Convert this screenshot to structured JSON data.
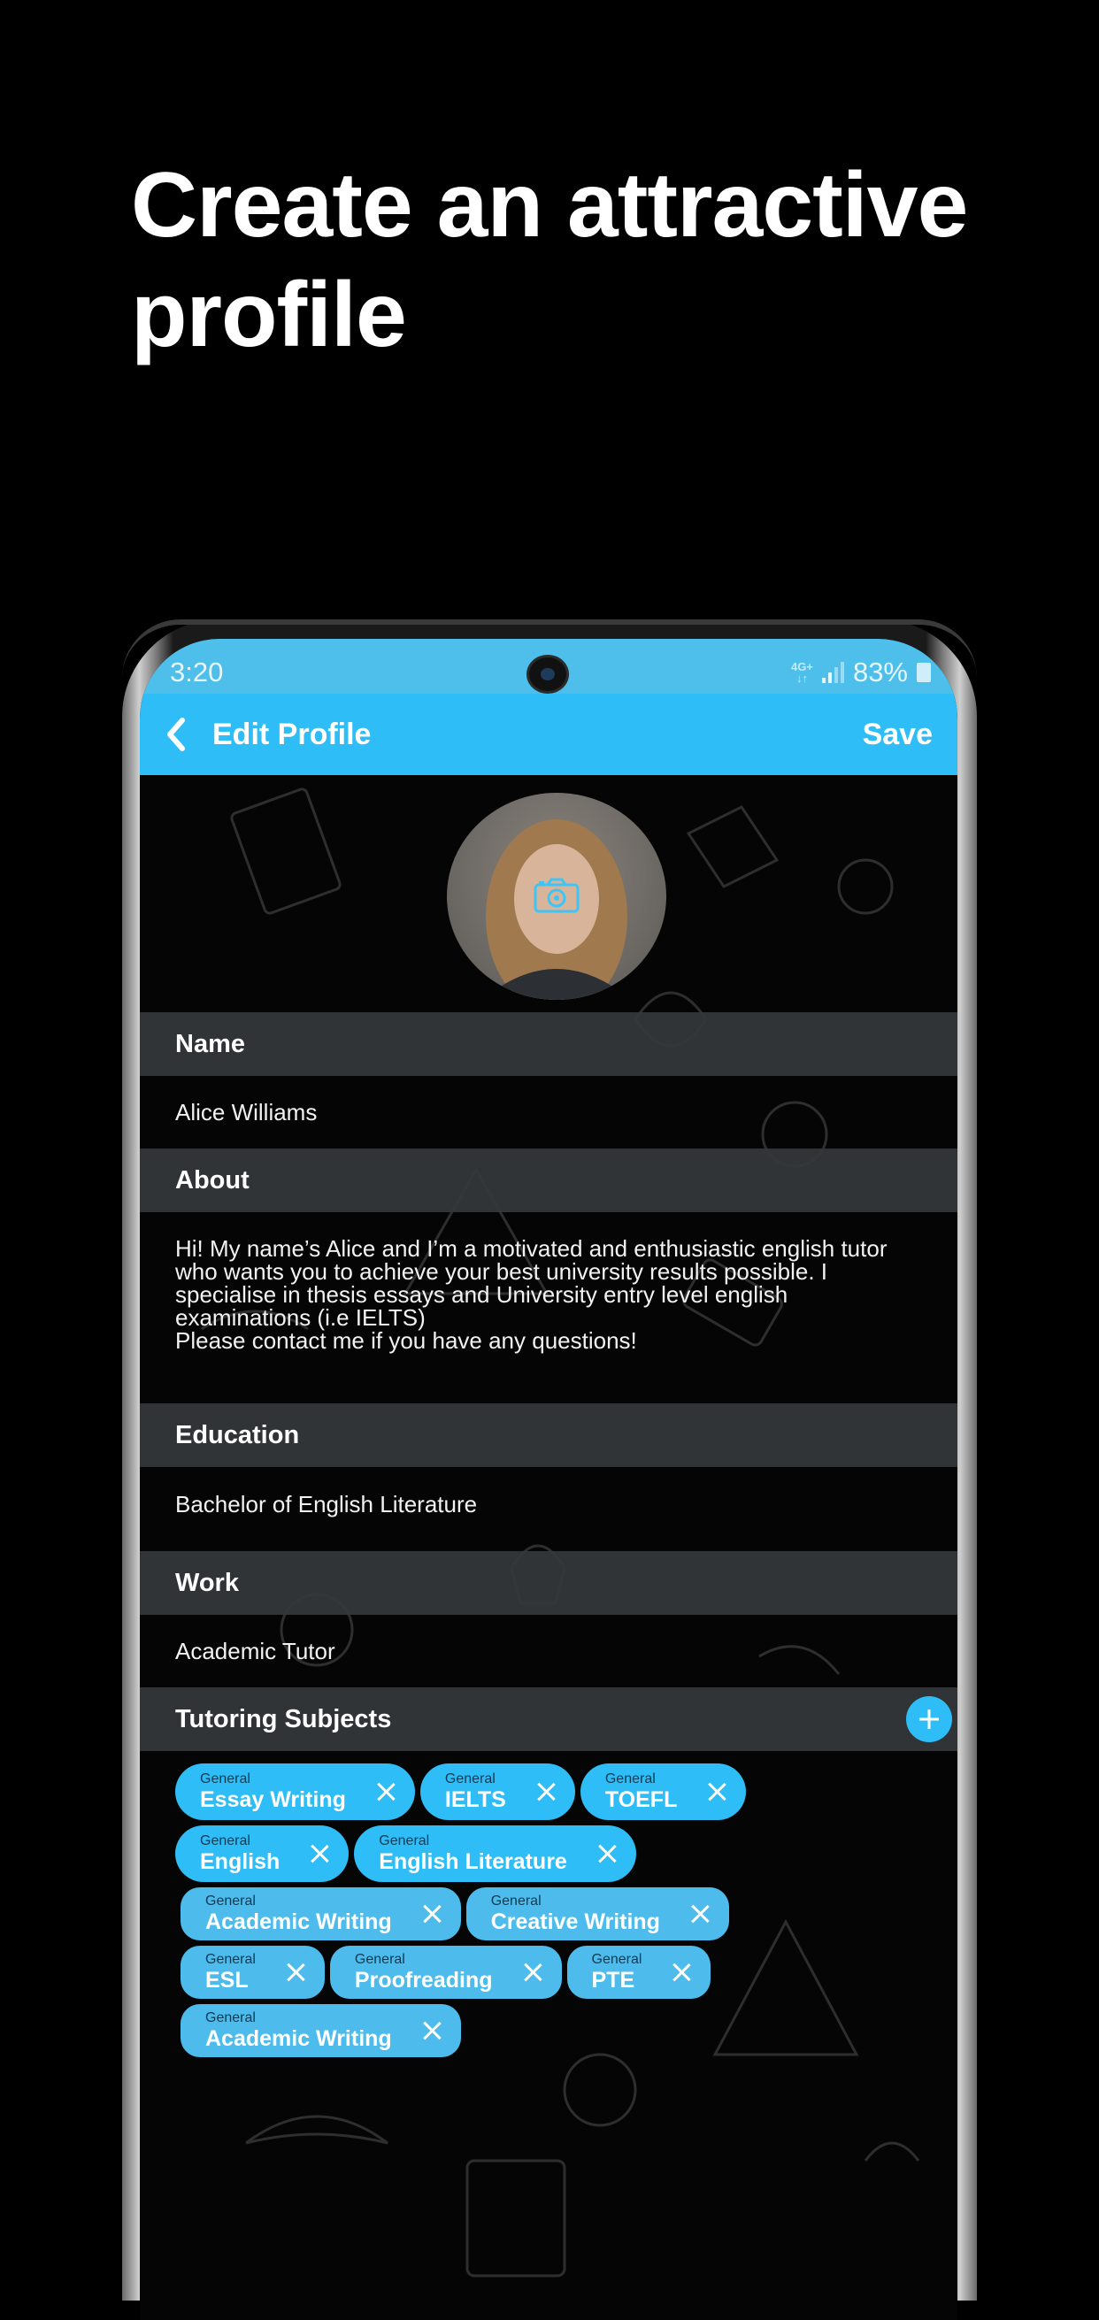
{
  "headline": "Create an attractive profile",
  "status_bar": {
    "time": "3:20",
    "network": "4G+",
    "battery": "83%"
  },
  "app_bar": {
    "title": "Edit Profile",
    "save_label": "Save"
  },
  "sections": {
    "name": {
      "label": "Name",
      "value": "Alice Williams"
    },
    "about": {
      "label": "About",
      "value": "Hi! My name’s Alice and I’m a motivated and enthusiastic english tutor who wants you to achieve your best university results possible. I specialise in thesis essays and University entry level english examinations (i.e IELTS)\nPlease contact me if you have any questions!"
    },
    "education": {
      "label": "Education",
      "value": "Bachelor of English Literature"
    },
    "work": {
      "label": "Work",
      "value": "Academic Tutor"
    },
    "subjects": {
      "label": "Tutoring Subjects"
    }
  },
  "subjects": [
    {
      "category": "General",
      "label": "Essay Writing"
    },
    {
      "category": "General",
      "label": "IELTS"
    },
    {
      "category": "General",
      "label": "TOEFL"
    },
    {
      "category": "General",
      "label": "English"
    },
    {
      "category": "General",
      "label": "English Literature"
    },
    {
      "category": "General",
      "label": "Academic Writing"
    },
    {
      "category": "General",
      "label": "Creative Writing"
    },
    {
      "category": "General",
      "label": "ESL"
    },
    {
      "category": "General",
      "label": "Proofreading"
    },
    {
      "category": "General",
      "label": "PTE"
    },
    {
      "category": "General",
      "label": "Academic Writing"
    }
  ],
  "colors": {
    "accent": "#2ebdf6",
    "section_header": "#34383c",
    "background": "#000000"
  }
}
